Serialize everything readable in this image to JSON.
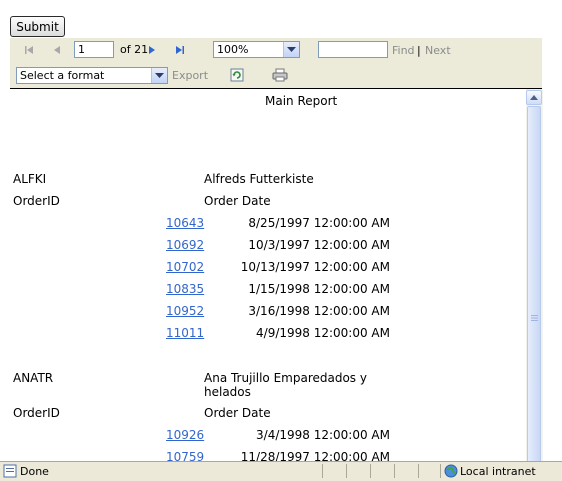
{
  "submit_label": "Submit",
  "toolbar": {
    "page_current": "1",
    "page_total_label": "of 21",
    "zoom_value": "100%",
    "find_label": "Find",
    "separator": "|",
    "next_label": "Next",
    "format_placeholder": "Select a format",
    "export_label": "Export"
  },
  "report": {
    "title": "Main Report",
    "orderid_header": "OrderID",
    "orderdate_header": "Order Date",
    "customers": [
      {
        "id": "ALFKI",
        "name": "Alfreds Futterkiste",
        "orders": [
          {
            "id": "10643",
            "date": "8/25/1997 12:00:00 AM"
          },
          {
            "id": "10692",
            "date": "10/3/1997 12:00:00 AM"
          },
          {
            "id": "10702",
            "date": "10/13/1997 12:00:00 AM"
          },
          {
            "id": "10835",
            "date": "1/15/1998 12:00:00 AM"
          },
          {
            "id": "10952",
            "date": "3/16/1998 12:00:00 AM"
          },
          {
            "id": "11011",
            "date": "4/9/1998 12:00:00 AM"
          }
        ]
      },
      {
        "id": "ANATR",
        "name_line1": "Ana Trujillo Emparedados y",
        "name_line2": "helados",
        "orders": [
          {
            "id": "10926",
            "date": "3/4/1998 12:00:00 AM"
          },
          {
            "id": "10759",
            "date": "11/28/1997 12:00:00 AM"
          }
        ]
      }
    ]
  },
  "status": {
    "text": "Done",
    "zone": "Local intranet"
  },
  "colors": {
    "toolbar_bg": "#ecebd9",
    "link": "#3366cc",
    "statusbar_bg": "#ece9d8"
  },
  "icons": [
    "first-page-icon",
    "previous-page-icon",
    "next-page-icon",
    "last-page-icon",
    "dropdown-arrow-icon",
    "refresh-icon",
    "print-icon",
    "page-done-icon",
    "intranet-globe-icon"
  ]
}
